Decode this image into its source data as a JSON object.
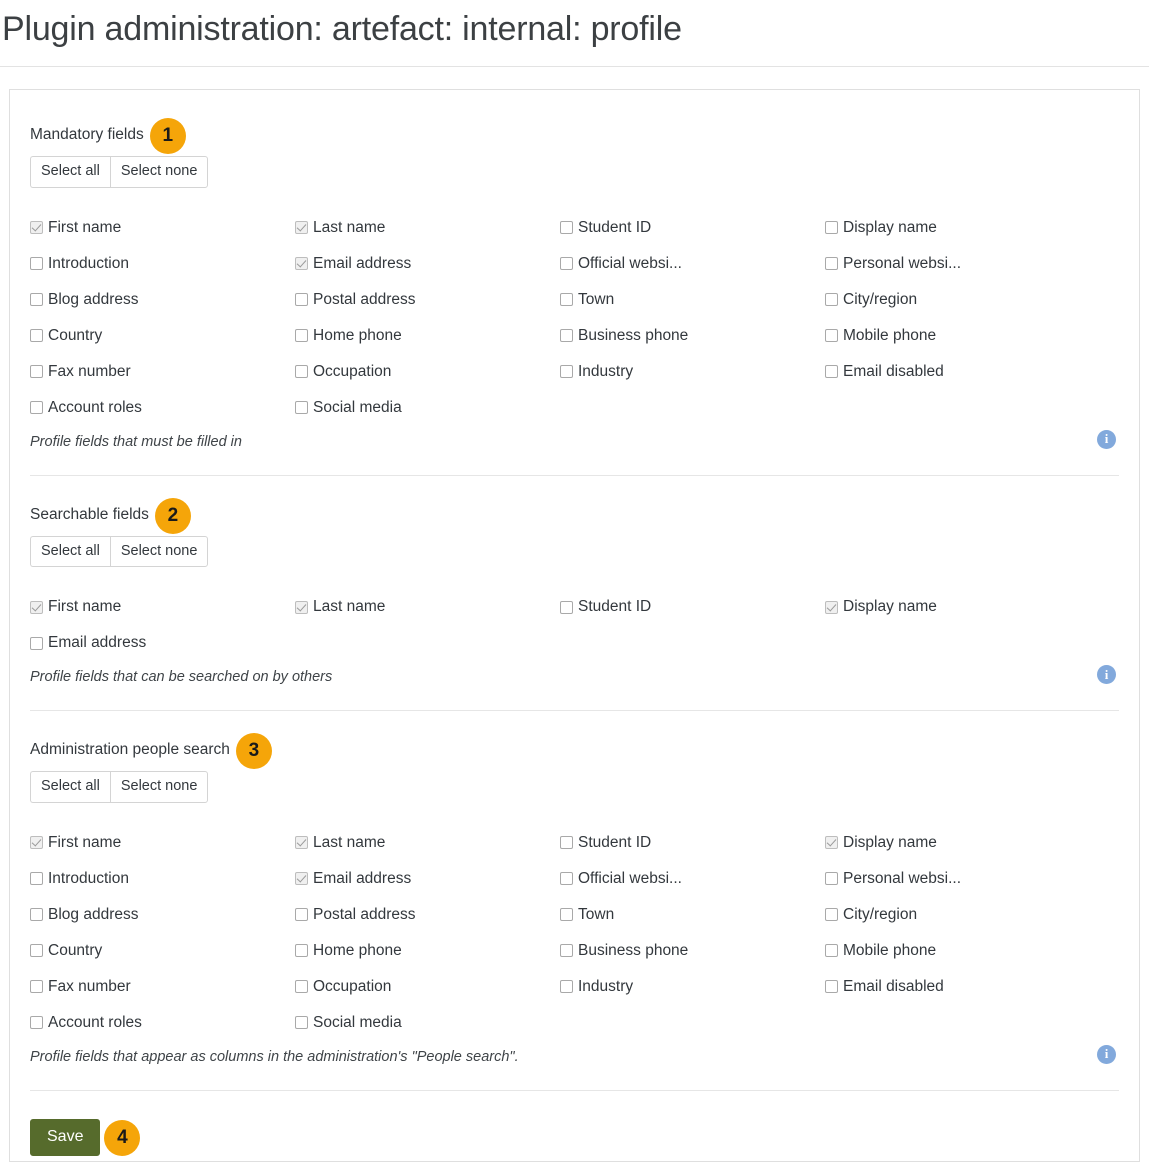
{
  "page": {
    "title": "Plugin administration: artefact: internal: profile"
  },
  "buttons": {
    "select_all": "Select all",
    "select_none": "Select none",
    "save": "Save"
  },
  "icons": {
    "info": "i"
  },
  "colors": {
    "callout_badge": "#f5a509",
    "save_button": "#566b2c",
    "info_icon": "#82a9dc",
    "card_border": "#dfdfdf"
  },
  "sections": [
    {
      "legend": "Mandatory fields",
      "callout": "1",
      "description": "Profile fields that must be filled in",
      "fields": [
        {
          "label": "First name",
          "checked": true
        },
        {
          "label": "Last name",
          "checked": true
        },
        {
          "label": "Student ID",
          "checked": false
        },
        {
          "label": "Display name",
          "checked": false
        },
        {
          "label": "Introduction",
          "checked": false
        },
        {
          "label": "Email address",
          "checked": true
        },
        {
          "label": "Official websi...",
          "checked": false
        },
        {
          "label": "Personal websi...",
          "checked": false
        },
        {
          "label": "Blog address",
          "checked": false
        },
        {
          "label": "Postal address",
          "checked": false
        },
        {
          "label": "Town",
          "checked": false
        },
        {
          "label": "City/region",
          "checked": false
        },
        {
          "label": "Country",
          "checked": false
        },
        {
          "label": "Home phone",
          "checked": false
        },
        {
          "label": "Business phone",
          "checked": false
        },
        {
          "label": "Mobile phone",
          "checked": false
        },
        {
          "label": "Fax number",
          "checked": false
        },
        {
          "label": "Occupation",
          "checked": false
        },
        {
          "label": "Industry",
          "checked": false
        },
        {
          "label": "Email disabled",
          "checked": false
        },
        {
          "label": "Account roles",
          "checked": false
        },
        {
          "label": "Social media",
          "checked": false
        }
      ]
    },
    {
      "legend": "Searchable fields",
      "callout": "2",
      "description": "Profile fields that can be searched on by others",
      "fields": [
        {
          "label": "First name",
          "checked": true
        },
        {
          "label": "Last name",
          "checked": true
        },
        {
          "label": "Student ID",
          "checked": false
        },
        {
          "label": "Display name",
          "checked": true
        },
        {
          "label": "Email address",
          "checked": false
        }
      ]
    },
    {
      "legend": "Administration people search",
      "callout": "3",
      "description": "Profile fields that appear as columns in the administration's \"People search\".",
      "fields": [
        {
          "label": "First name",
          "checked": true
        },
        {
          "label": "Last name",
          "checked": true
        },
        {
          "label": "Student ID",
          "checked": false
        },
        {
          "label": "Display name",
          "checked": true
        },
        {
          "label": "Introduction",
          "checked": false
        },
        {
          "label": "Email address",
          "checked": true
        },
        {
          "label": "Official websi...",
          "checked": false
        },
        {
          "label": "Personal websi...",
          "checked": false
        },
        {
          "label": "Blog address",
          "checked": false
        },
        {
          "label": "Postal address",
          "checked": false
        },
        {
          "label": "Town",
          "checked": false
        },
        {
          "label": "City/region",
          "checked": false
        },
        {
          "label": "Country",
          "checked": false
        },
        {
          "label": "Home phone",
          "checked": false
        },
        {
          "label": "Business phone",
          "checked": false
        },
        {
          "label": "Mobile phone",
          "checked": false
        },
        {
          "label": "Fax number",
          "checked": false
        },
        {
          "label": "Occupation",
          "checked": false
        },
        {
          "label": "Industry",
          "checked": false
        },
        {
          "label": "Email disabled",
          "checked": false
        },
        {
          "label": "Account roles",
          "checked": false
        },
        {
          "label": "Social media",
          "checked": false
        }
      ]
    }
  ],
  "footer": {
    "callout": "4"
  }
}
